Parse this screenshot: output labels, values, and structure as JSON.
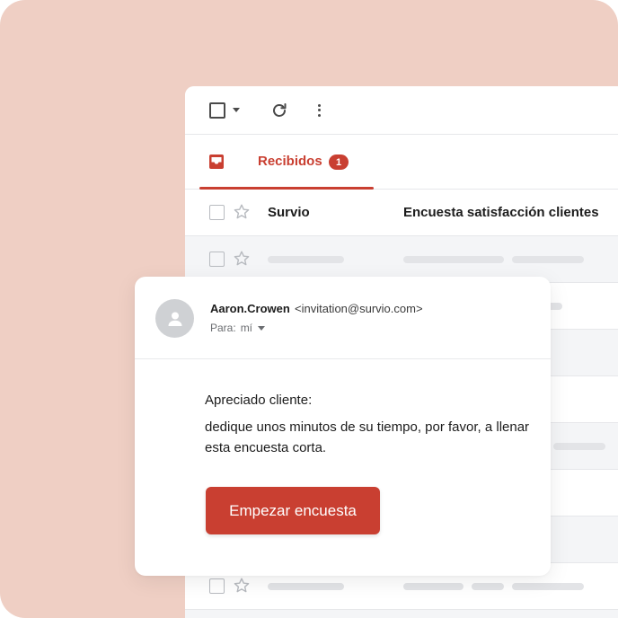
{
  "colors": {
    "background": "#efcfc4",
    "accent": "#c93f31"
  },
  "toolbar": {
    "icons": [
      "checkbox-icon",
      "chevron-down-icon",
      "refresh-icon",
      "more-vert-icon"
    ]
  },
  "tab": {
    "label": "Recibidos",
    "badge": "1",
    "icon": "inbox-icon"
  },
  "inbox_rows": [
    {
      "sender": "Survio",
      "subject": "Encuesta satisfacción clientes"
    }
  ],
  "email": {
    "from_name": "Aaron.Crowen",
    "from_address": "<invitation@survio.com>",
    "to_label": "Para:",
    "to_value": "mí",
    "greeting": "Apreciado cliente:",
    "body": "dedique unos minutos de su tiempo, por favor, a llenar esta encuesta corta.",
    "cta_label": "Empezar encuesta"
  }
}
